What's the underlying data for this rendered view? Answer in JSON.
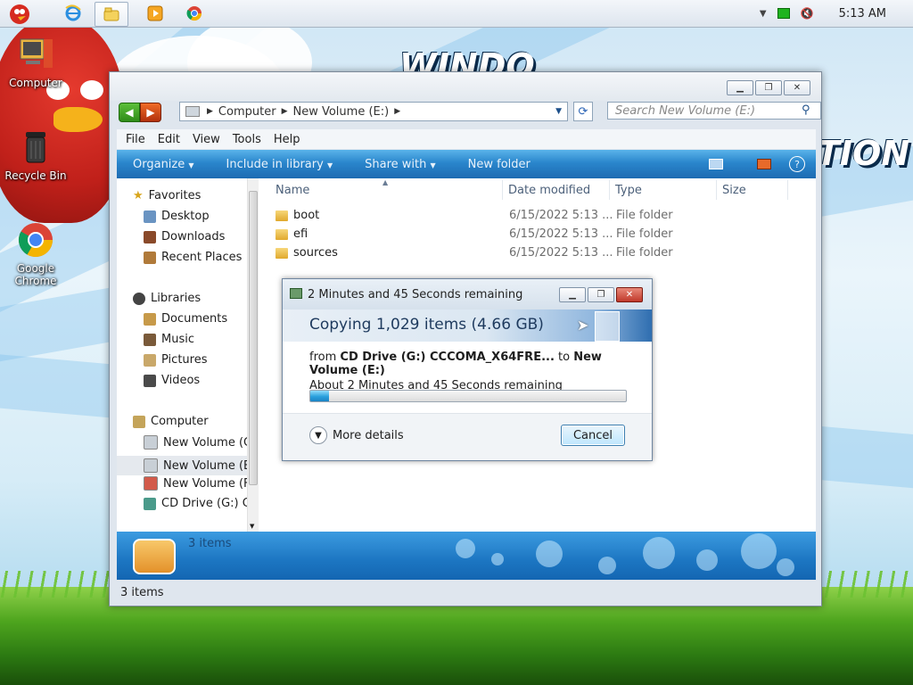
{
  "taskbar": {
    "clock": "5:13 AM",
    "buttons": [
      "angry-birds",
      "internet-explorer",
      "windows-explorer",
      "media-player",
      "chrome"
    ]
  },
  "wallpaper": {
    "text1": "WINDO",
    "text2": "TION"
  },
  "desktop": {
    "icons": [
      {
        "label": "Computer",
        "icon": "computer-icon"
      },
      {
        "label": "Recycle Bin",
        "icon": "recycle-bin-icon"
      },
      {
        "label": "Google Chrome",
        "icon": "chrome-icon"
      }
    ]
  },
  "explorer": {
    "breadcrumb": [
      "Computer",
      "New Volume (E:)"
    ],
    "search_placeholder": "Search New Volume (E:)",
    "menu": [
      "File",
      "Edit",
      "View",
      "Tools",
      "Help"
    ],
    "commands": [
      "Organize",
      "Include in library",
      "Share with",
      "New folder"
    ],
    "nav": {
      "favorites_header": "Favorites",
      "favorites": [
        "Desktop",
        "Downloads",
        "Recent Places"
      ],
      "libraries_header": "Libraries",
      "libraries": [
        "Documents",
        "Music",
        "Pictures",
        "Videos"
      ],
      "computer_header": "Computer",
      "drives": [
        "New Volume (C",
        "New Volume (E",
        "New Volume (F",
        "CD Drive (G:) C("
      ]
    },
    "columns": [
      "Name",
      "Date modified",
      "Type",
      "Size"
    ],
    "files": [
      {
        "name": "boot",
        "date": "6/15/2022 5:13 ...",
        "type": "File folder"
      },
      {
        "name": "efi",
        "date": "6/15/2022 5:13 ...",
        "type": "File folder"
      },
      {
        "name": "sources",
        "date": "6/15/2022 5:13 ...",
        "type": "File folder"
      }
    ],
    "details_text": "3 items",
    "status": "3 items"
  },
  "copy_dialog": {
    "title": "2 Minutes and 45 Seconds remaining",
    "heading": "Copying 1,029 items (4.66 GB)",
    "from_label": "from",
    "from_source": "CD Drive (G:) CCCOMA_X64FRE...",
    "to_label": "to",
    "to_dest": "New Volume (E:)",
    "remaining": "About 2 Minutes and 45 Seconds remaining",
    "progress": 0.06,
    "more_details": "More details",
    "cancel": "Cancel"
  }
}
